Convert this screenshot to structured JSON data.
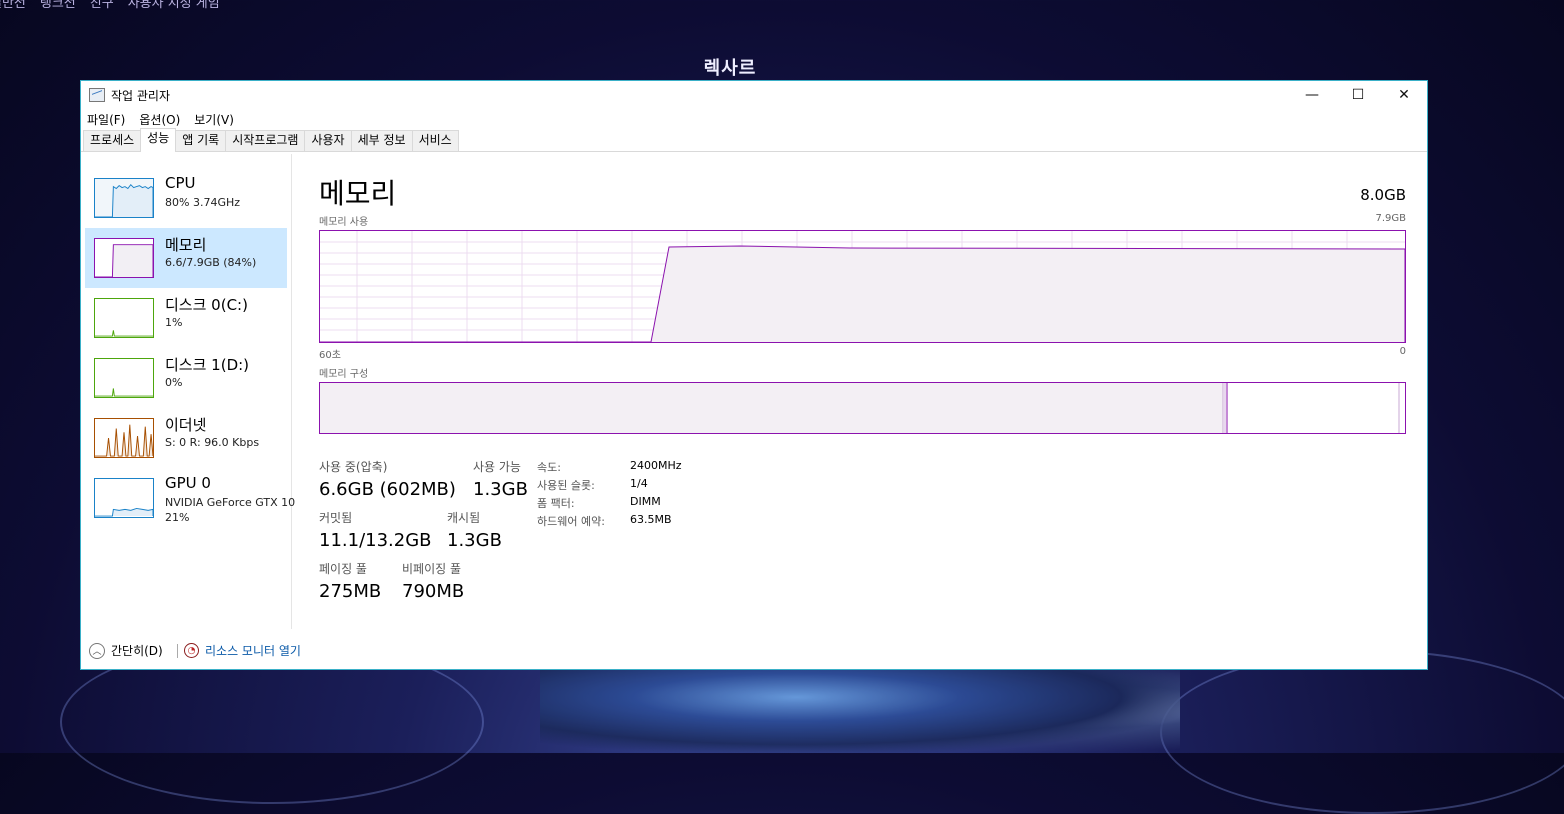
{
  "background": {
    "nav": [
      "일반전",
      "랭크전",
      "친구",
      "사용자 지정 게임"
    ],
    "hero_name": "렉사르"
  },
  "window": {
    "title": "작업 관리자",
    "controls": {
      "minimize": "—",
      "maximize": "☐",
      "close": "✕"
    }
  },
  "menu": [
    "파일(F)",
    "옵션(O)",
    "보기(V)"
  ],
  "tabs": [
    "프로세스",
    "성능",
    "앱 기록",
    "시작프로그램",
    "사용자",
    "세부 정보",
    "서비스"
  ],
  "active_tab": "성능",
  "sidebar": {
    "items": [
      {
        "name": "CPU",
        "sub": "80% 3.74GHz",
        "sub2": "",
        "color": "#1a82c8"
      },
      {
        "name": "메모리",
        "sub": "6.6/7.9GB (84%)",
        "sub2": "",
        "color": "#8b12ae"
      },
      {
        "name": "디스크 0(C:)",
        "sub": "1%",
        "sub2": "",
        "color": "#4da60c"
      },
      {
        "name": "디스크 1(D:)",
        "sub": "0%",
        "sub2": "",
        "color": "#4da60c"
      },
      {
        "name": "이더넷",
        "sub": "S: 0 R: 96.0 Kbps",
        "sub2": "",
        "color": "#a74f01"
      },
      {
        "name": "GPU 0",
        "sub": "NVIDIA GeForce GTX 10",
        "sub2": "21%",
        "color": "#1a82c8"
      }
    ]
  },
  "memory": {
    "title": "메모리",
    "total": "8.0GB",
    "usage_label": "메모리 사용",
    "usage_max": "7.9GB",
    "axis_left": "60초",
    "axis_right": "0",
    "composition_label": "메모리 구성",
    "accent_color": "#8b12ae",
    "usage_fraction": 0.84,
    "stats": {
      "in_use_label": "사용 중(압축)",
      "in_use_value": "6.6GB (602MB)",
      "available_label": "사용 가능",
      "available_value": "1.3GB",
      "committed_label": "커밋됨",
      "committed_value": "11.1/13.2GB",
      "cached_label": "캐시됨",
      "cached_value": "1.3GB",
      "paged_label": "페이징 풀",
      "paged_value": "275MB",
      "nonpaged_label": "비페이징 풀",
      "nonpaged_value": "790MB"
    },
    "details": [
      {
        "label": "속도:",
        "value": "2400MHz"
      },
      {
        "label": "사용된 슬롯:",
        "value": "1/4"
      },
      {
        "label": "폼 팩터:",
        "value": "DIMM"
      },
      {
        "label": "하드웨어 예약:",
        "value": "63.5MB"
      }
    ]
  },
  "footer": {
    "collapse": "간단히(D)",
    "resource_monitor": "리소스 모니터 열기"
  }
}
